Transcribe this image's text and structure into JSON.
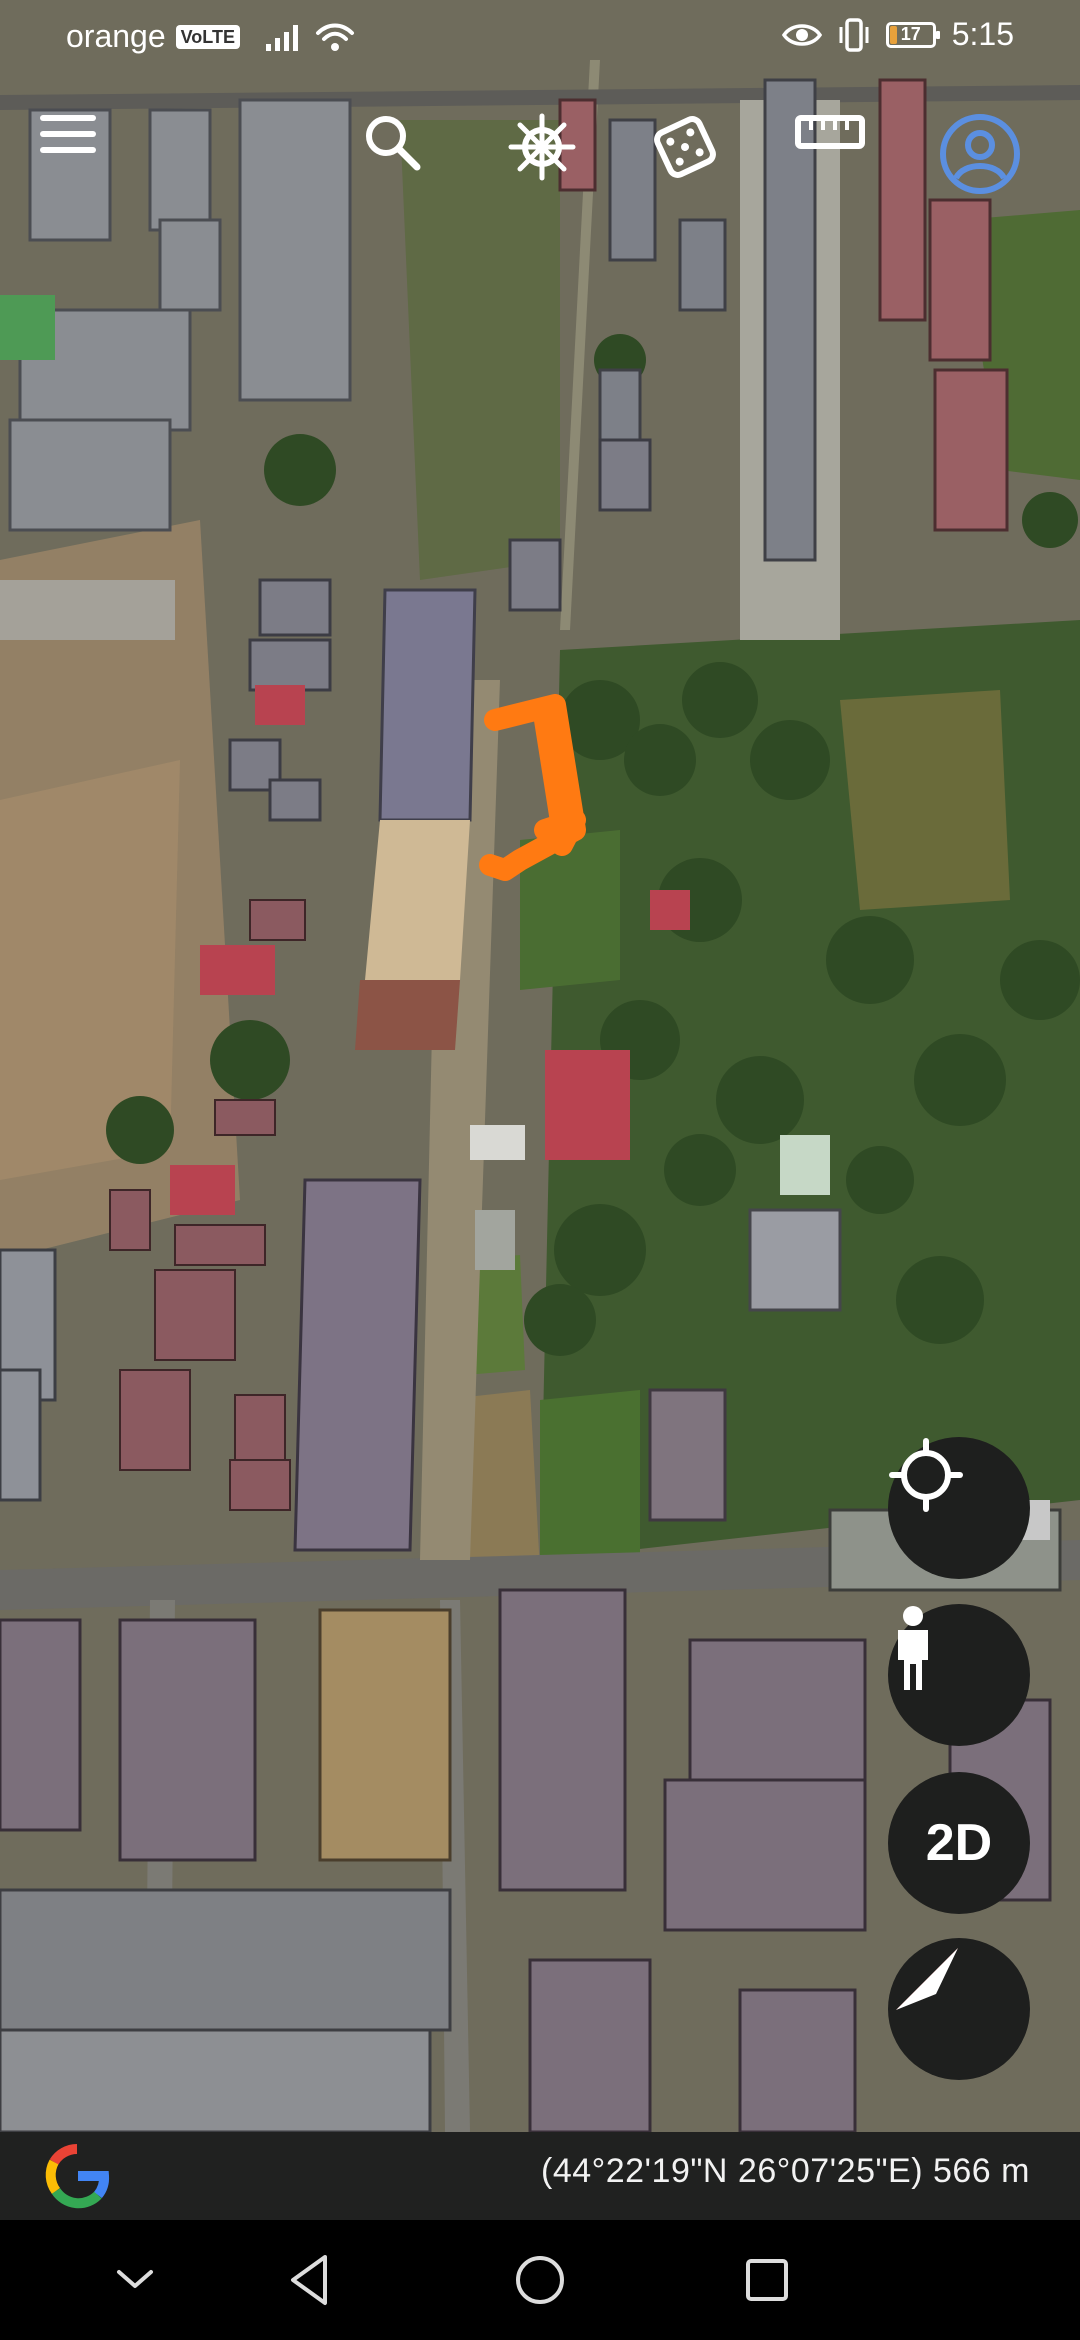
{
  "status_bar": {
    "carrier": "orange",
    "volte_badge": "VoLTE",
    "battery_level": "17",
    "battery_fraction": 0.17,
    "time": "5:15"
  },
  "toolbar": {
    "icons": [
      "menu-icon",
      "search-icon",
      "ship-wheel-icon",
      "dice-icon",
      "ruler-icon",
      "account-icon"
    ]
  },
  "map_controls": {
    "locate_icon": "crosshair-icon",
    "street_view_icon": "pegman-icon",
    "view_mode_label": "2D",
    "compass_icon": "compass-icon"
  },
  "footer": {
    "logo": "Google G",
    "coordinates": "(44°22'19\"N 26°07'25\"E) 566 m"
  },
  "nav": {
    "icons": [
      "back-chevron-icon",
      "back-triangle-icon",
      "home-circle-icon",
      "recents-square-icon"
    ]
  },
  "colors": {
    "annotation_orange": "#ff7a12",
    "account_blue": "#5b8fe0",
    "compass_red": "#e03b2e",
    "button_bg": "#1e1f1e"
  }
}
